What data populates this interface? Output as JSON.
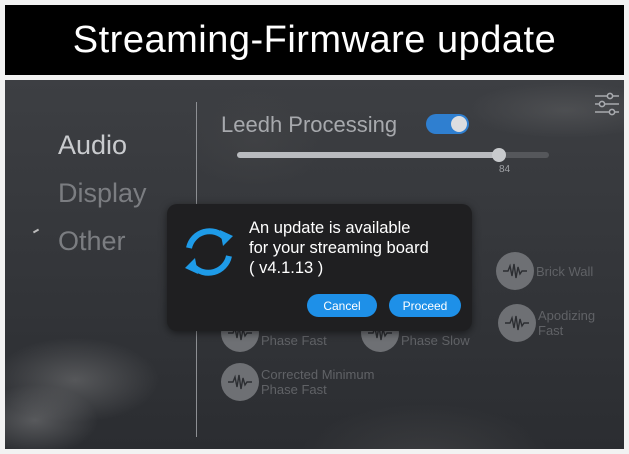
{
  "header": {
    "title": "Streaming-Firmware update"
  },
  "sidebar": {
    "items": [
      {
        "label": "Audio",
        "active": true
      },
      {
        "label": "Display",
        "active": false
      },
      {
        "label": "Other",
        "active": false
      }
    ]
  },
  "processing": {
    "label": "Leedh Processing",
    "enabled": true,
    "value": "84",
    "level_fraction": 0.84
  },
  "filters": [
    {
      "label": "Brick Wall"
    },
    {
      "label": "Phase Fast"
    },
    {
      "label": "Phase Slow"
    },
    {
      "label": "Apodizing Fast"
    },
    {
      "label": "Corrected Minimum Phase Fast"
    }
  ],
  "dialog": {
    "line1": "An update is available",
    "line2": "for your streaming board",
    "line3": "( v4.1.13 )",
    "cancel_label": "Cancel",
    "proceed_label": "Proceed"
  },
  "icons": {
    "settings": "settings-sliders-icon",
    "update": "sync-icon",
    "filter": "waveform-icon"
  },
  "colors": {
    "accent": "#1e90e8",
    "toggle": "#2f7fd0",
    "dialog_bg": "#1f1f21"
  }
}
